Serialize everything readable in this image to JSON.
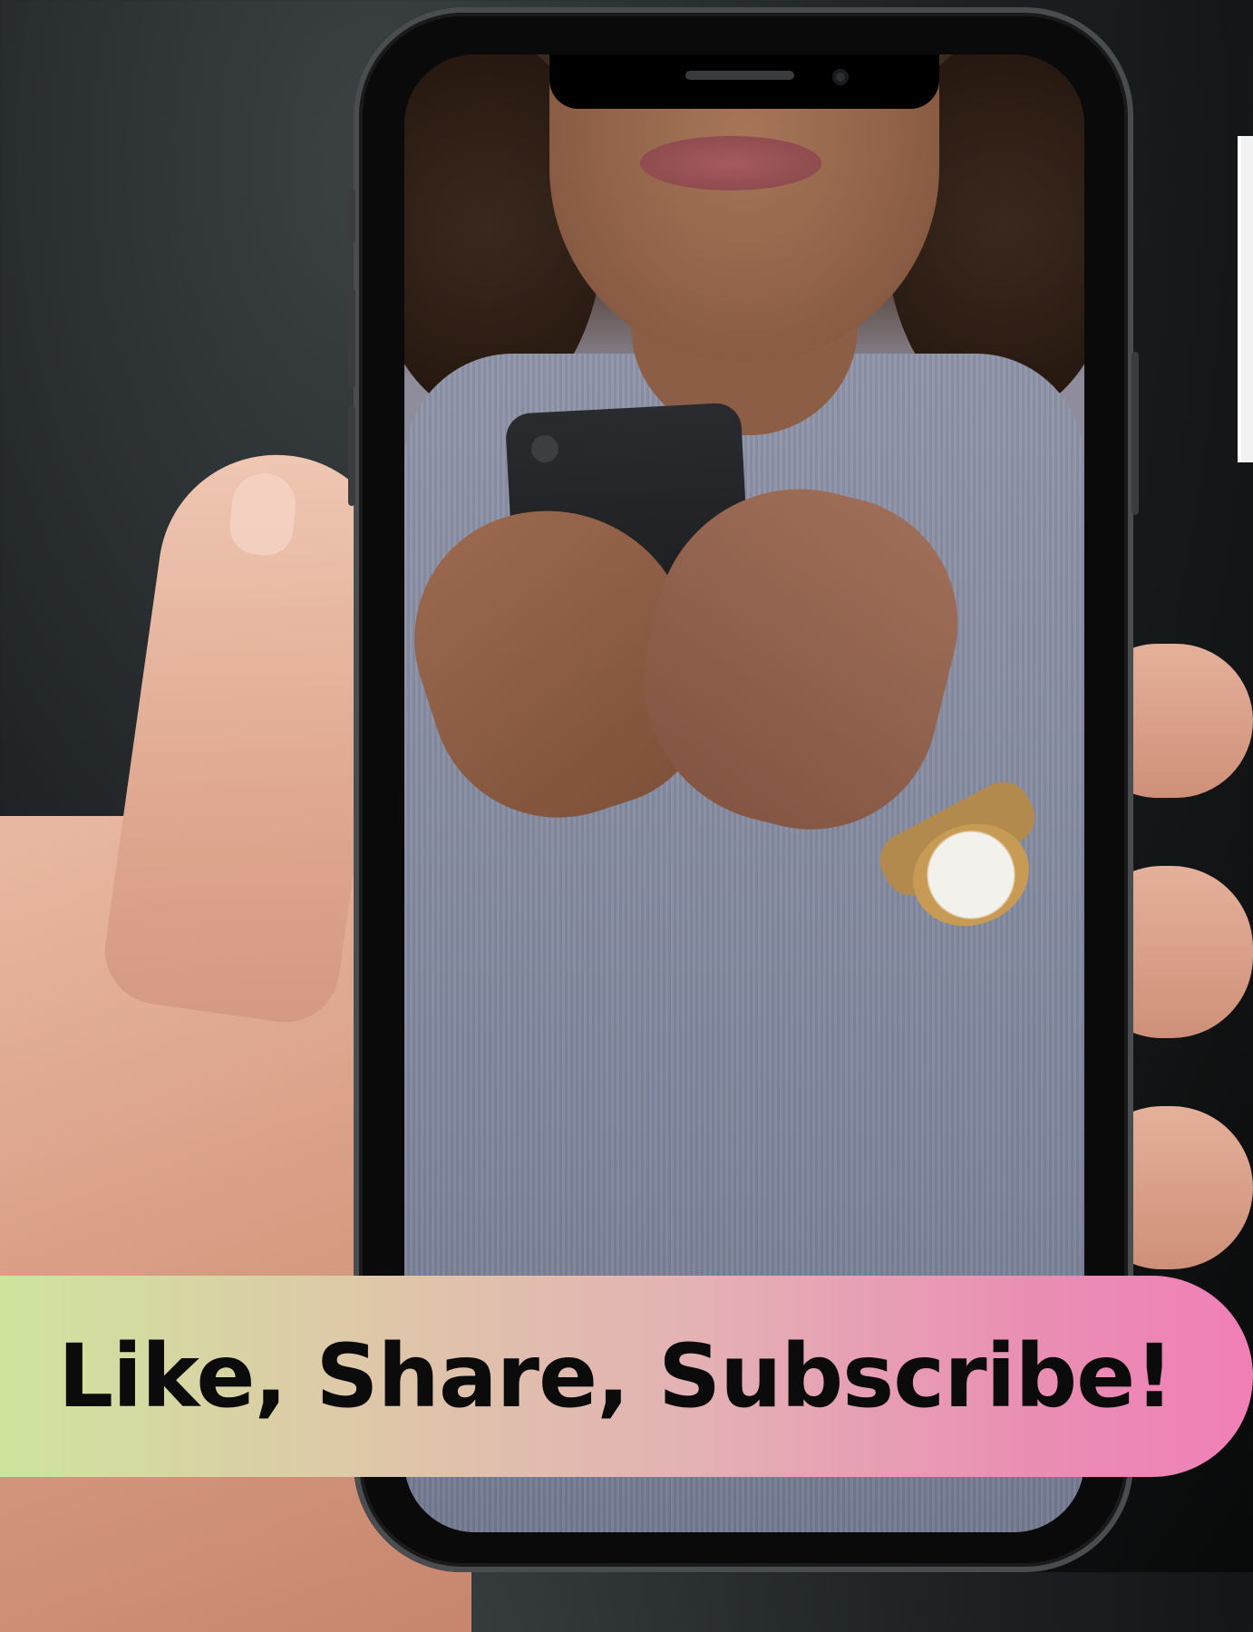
{
  "banner": {
    "text": "Like, Share, Subscribe!"
  },
  "colors": {
    "background": "#1e2224",
    "banner_gradient_start": "#cfe49e",
    "banner_gradient_end": "#f07fb6",
    "banner_text": "#0b0b0b",
    "phone_body": "#0a0a0a"
  },
  "icons": [
    "phone-notch-speaker-icon",
    "front-camera-icon"
  ]
}
